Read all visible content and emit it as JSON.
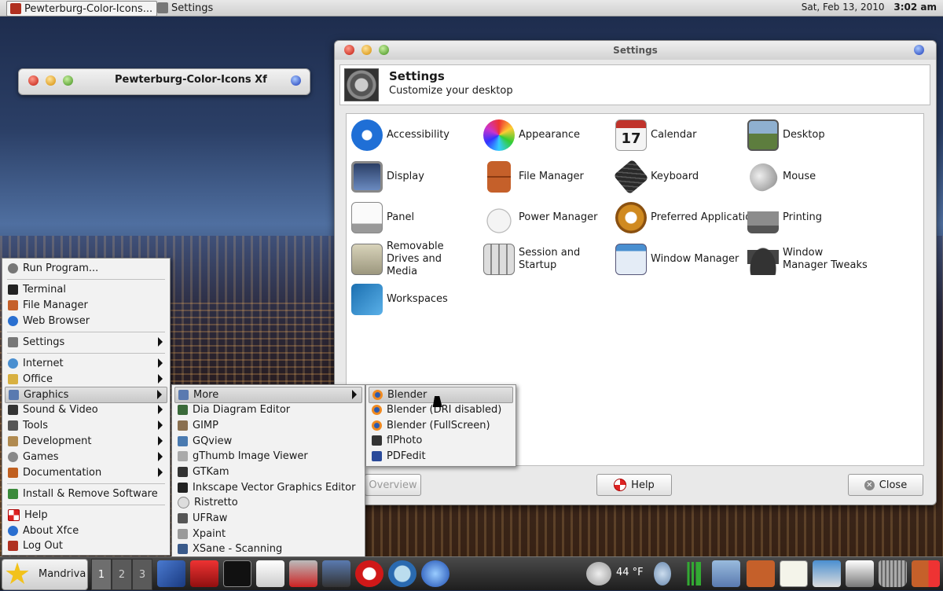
{
  "top_panel": {
    "tasks": [
      {
        "label": "Pewterburg-Color-Icons...",
        "active": true
      },
      {
        "label": "Settings",
        "active": false
      }
    ],
    "date": "Sat, Feb 13, 2010",
    "time": "3:02 am"
  },
  "mini_window": {
    "title": "Pewterburg-Color-Icons Xf"
  },
  "settings": {
    "window_title": "Settings",
    "header_title": "Settings",
    "header_subtitle": "Customize your desktop",
    "items": [
      {
        "label": "Accessibility",
        "icon": "accessibility-icon",
        "color": "#1f6fd6"
      },
      {
        "label": "Appearance",
        "icon": "appearance-icon",
        "color": "#d95bd0"
      },
      {
        "label": "Calendar",
        "icon": "calendar-icon",
        "color": "#c0332b",
        "badge": "17"
      },
      {
        "label": "Desktop",
        "icon": "desktop-icon",
        "color": "#5d7d3e"
      },
      {
        "label": "Display",
        "icon": "display-icon",
        "color": "#2b3f66"
      },
      {
        "label": "File Manager",
        "icon": "file-manager-icon",
        "color": "#c5602a"
      },
      {
        "label": "Keyboard",
        "icon": "keyboard-icon",
        "color": "#2a2a2a"
      },
      {
        "label": "Mouse",
        "icon": "mouse-icon",
        "color": "#a8a8a8"
      },
      {
        "label": "Panel",
        "icon": "panel-icon",
        "color": "#e8e8e8"
      },
      {
        "label": "Power Manager",
        "icon": "power-manager-icon",
        "color": "#d8d8d8"
      },
      {
        "label": "Preferred Applications",
        "icon": "preferred-applications-icon",
        "color": "#d08a20"
      },
      {
        "label": "Printing",
        "icon": "printer-icon",
        "color": "#8c8c8c"
      },
      {
        "label": "Removable Drives and Media",
        "icon": "removable-drive-icon",
        "color": "#b8b39a"
      },
      {
        "label": "Session and Startup",
        "icon": "session-startup-icon",
        "color": "#bcbcbc"
      },
      {
        "label": "Window Manager",
        "icon": "window-manager-icon",
        "color": "#4a8fd0"
      },
      {
        "label": "Window Manager Tweaks",
        "icon": "window-tweaks-icon",
        "color": "#333333"
      },
      {
        "label": "Workspaces",
        "icon": "workspaces-icon",
        "color": "#1b6fb0"
      }
    ],
    "overview_label": "Overview",
    "help_label": "Help",
    "close_label": "Close"
  },
  "main_menu": {
    "items": [
      {
        "label": "Run Program...",
        "icon": "run-icon"
      },
      {
        "label": "Terminal",
        "icon": "terminal-icon"
      },
      {
        "label": "File Manager",
        "icon": "file-manager-icon"
      },
      {
        "label": "Web Browser",
        "icon": "web-browser-icon"
      },
      {
        "label": "Settings",
        "icon": "settings-icon",
        "submenu": true
      },
      {
        "label": "Internet",
        "icon": "internet-icon",
        "submenu": true
      },
      {
        "label": "Office",
        "icon": "office-icon",
        "submenu": true
      },
      {
        "label": "Graphics",
        "icon": "graphics-icon",
        "submenu": true,
        "highlighted": true
      },
      {
        "label": "Sound & Video",
        "icon": "sound-video-icon",
        "submenu": true
      },
      {
        "label": "Tools",
        "icon": "tools-icon",
        "submenu": true
      },
      {
        "label": "Development",
        "icon": "development-icon",
        "submenu": true
      },
      {
        "label": "Games",
        "icon": "games-icon",
        "submenu": true
      },
      {
        "label": "Documentation",
        "icon": "documentation-icon",
        "submenu": true
      },
      {
        "label": "Install & Remove Software",
        "icon": "install-software-icon"
      },
      {
        "label": "Help",
        "icon": "help-icon"
      },
      {
        "label": "About Xfce",
        "icon": "about-icon"
      },
      {
        "label": "Log Out",
        "icon": "logout-icon"
      }
    ]
  },
  "graphics_menu": {
    "items": [
      {
        "label": "More",
        "icon": "more-icon",
        "submenu": true,
        "highlighted": true
      },
      {
        "label": "Dia Diagram Editor",
        "icon": "dia-icon"
      },
      {
        "label": "GIMP",
        "icon": "gimp-icon"
      },
      {
        "label": "GQview",
        "icon": "gqview-icon"
      },
      {
        "label": "gThumb Image Viewer",
        "icon": "gthumb-icon"
      },
      {
        "label": "GTKam",
        "icon": "gtkam-icon"
      },
      {
        "label": "Inkscape Vector Graphics Editor",
        "icon": "inkscape-icon"
      },
      {
        "label": "Ristretto",
        "icon": "ristretto-icon"
      },
      {
        "label": "UFRaw",
        "icon": "ufraw-icon"
      },
      {
        "label": "Xpaint",
        "icon": "xpaint-icon"
      },
      {
        "label": "XSane - Scanning",
        "icon": "xsane-icon"
      }
    ]
  },
  "more_menu": {
    "items": [
      {
        "label": "Blender",
        "icon": "blender-icon",
        "highlighted": true
      },
      {
        "label": "Blender (DRI disabled)",
        "icon": "blender-icon"
      },
      {
        "label": "Blender (FullScreen)",
        "icon": "blender-icon"
      },
      {
        "label": "flPhoto",
        "icon": "flphoto-icon"
      },
      {
        "label": "PDFedit",
        "icon": "pdfedit-icon"
      }
    ]
  },
  "bottom_panel": {
    "start_label": "Mandriva",
    "workspaces": [
      "1",
      "2",
      "3"
    ],
    "weather": "44 °F"
  }
}
